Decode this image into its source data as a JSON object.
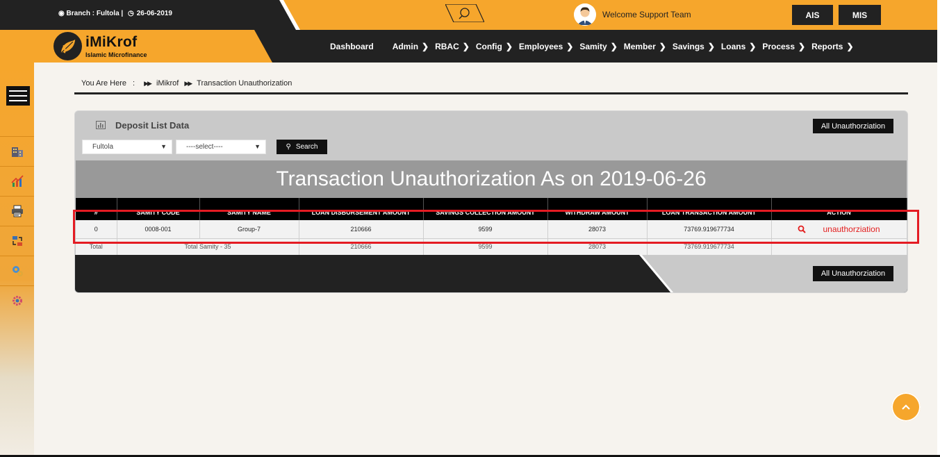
{
  "topbar": {
    "branch_label": "Branch : Fultola |",
    "date": "26-06-2019",
    "welcome": "Welcome Support Team",
    "ais_label": "AIS",
    "mis_label": "MIS"
  },
  "logo": {
    "title": "iMiKrof",
    "subtitle": "Islamic Microfinance"
  },
  "nav": {
    "items": [
      {
        "label": "Dashboard",
        "chevron": false
      },
      {
        "label": "Admin",
        "chevron": true
      },
      {
        "label": "RBAC",
        "chevron": true
      },
      {
        "label": "Config",
        "chevron": true
      },
      {
        "label": "Employees",
        "chevron": true
      },
      {
        "label": "Samity",
        "chevron": true
      },
      {
        "label": "Member",
        "chevron": true
      },
      {
        "label": "Savings",
        "chevron": true
      },
      {
        "label": "Loans",
        "chevron": true
      },
      {
        "label": "Process",
        "chevron": true
      },
      {
        "label": "Reports",
        "chevron": true
      }
    ]
  },
  "sidebar": {
    "icons": [
      "building-icon",
      "chart-up-icon",
      "printer-icon",
      "transfer-icon",
      "gears-icon",
      "settings-cog-icon"
    ]
  },
  "breadcrumb": {
    "you_are_here": "You Are Here",
    "root": "iMikrof",
    "current": "Transaction Unauthorization"
  },
  "panel": {
    "title": "Deposit List Data",
    "all_unauth_label": "All Unauthorziation",
    "branch_select": "Fultola",
    "samity_select": "----select----",
    "search_label": "Search",
    "banner": "Transaction Unauthorization As on 2019-06-26"
  },
  "table": {
    "headers": [
      "#",
      "SAMITY CODE",
      "SAMITY NAME",
      "LOAN DISBURSEMENT AMOUNT",
      "SAVINGS COLLECTION AMOUNT",
      "WITHDRAW AMOUNT",
      "LOAN TRANSACTION AMOUNT",
      "ACTION"
    ],
    "row": {
      "index": "0",
      "samity_code": "0008-001",
      "samity_name": "Group-7",
      "loan_disbursement": "210666",
      "savings_collection": "9599",
      "withdraw": "28073",
      "loan_transaction": "73769.919677734",
      "action_label": "unauthorziation"
    },
    "total": {
      "label": "Total",
      "samity_count": "Total Samity - 35",
      "loan_disbursement": "210666",
      "savings_collection": "9599",
      "withdraw": "28073",
      "loan_transaction": "73769.919677734"
    }
  },
  "colors": {
    "brand_orange": "#f6a62c",
    "dark": "#222222",
    "action_red": "#e31d1d",
    "highlight_red": "#e41b23"
  }
}
